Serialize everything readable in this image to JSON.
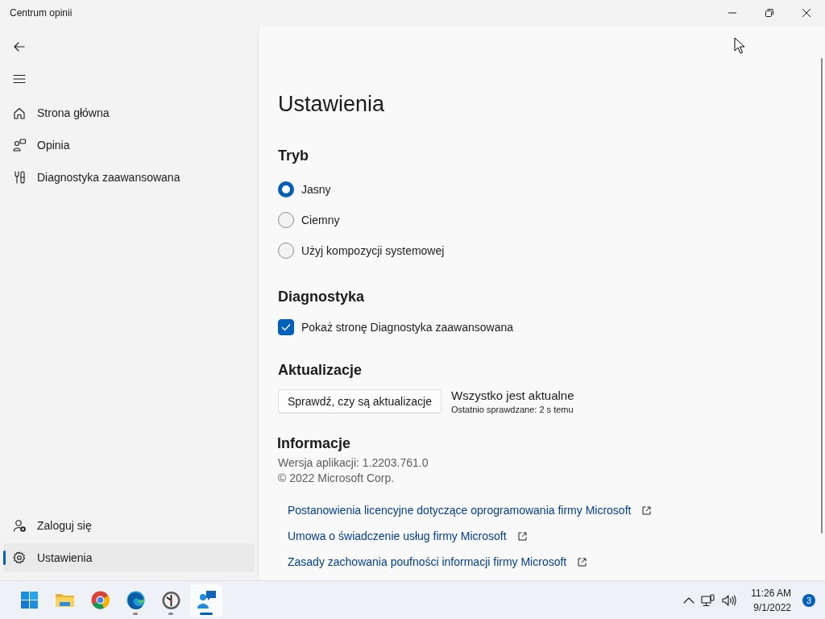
{
  "window": {
    "title": "Centrum opinii"
  },
  "sidebar": {
    "items": [
      {
        "label": "Strona główna",
        "kind": "home",
        "selected": false
      },
      {
        "label": "Opinia",
        "kind": "feedback",
        "selected": false
      },
      {
        "label": "Diagnostyka zaawansowana",
        "kind": "tools",
        "selected": false
      }
    ],
    "footer_items": [
      {
        "label": "Zaloguj się",
        "kind": "signin",
        "selected": false
      },
      {
        "label": "Ustawienia",
        "kind": "settings",
        "selected": true
      }
    ]
  },
  "settings": {
    "title": "Ustawienia",
    "mode": {
      "heading": "Tryb",
      "options": [
        {
          "label": "Jasny",
          "selected": true
        },
        {
          "label": "Ciemny",
          "selected": false
        },
        {
          "label": "Użyj kompozycji systemowej",
          "selected": false
        }
      ]
    },
    "diagnostics": {
      "heading": "Diagnostyka",
      "checkbox": {
        "label": "Pokaż stronę Diagnostyka zaawansowana",
        "checked": true
      }
    },
    "updates": {
      "heading": "Aktualizacje",
      "button": "Sprawdź, czy są aktualizacje",
      "status": "Wszystko jest aktualne",
      "last_checked": "Ostatnio sprawdzane: 2 s temu"
    },
    "about": {
      "heading": "Informacje",
      "version": "Wersja aplikacji: 1.2203.761.0",
      "copyright": "© 2022 Microsoft Corp.",
      "links": [
        "Postanowienia licencyjne dotyczące oprogramowania firmy Microsoft",
        "Umowa o świadczenie usług firmy Microsoft",
        "Zasady zachowania poufności informacji firmy Microsoft"
      ]
    }
  },
  "taskbar": {
    "apps": [
      {
        "kind": "start",
        "running": false,
        "active": false
      },
      {
        "kind": "folder",
        "running": false,
        "active": false
      },
      {
        "kind": "chrome",
        "running": false,
        "active": false
      },
      {
        "kind": "edge",
        "running": true,
        "active": false
      },
      {
        "kind": "clock",
        "running": true,
        "active": false
      },
      {
        "kind": "feedback",
        "running": true,
        "active": true
      }
    ],
    "time": "11:26 AM",
    "date": "9/1/2022",
    "notifications": "3"
  }
}
